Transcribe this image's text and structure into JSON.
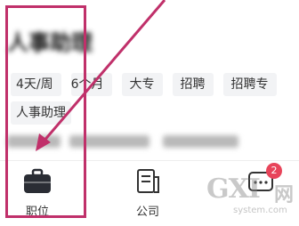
{
  "header": {
    "job_title": "人事助理"
  },
  "filters": {
    "chips": [
      "4天/周",
      "6个月",
      "大专",
      "招聘",
      "招聘专"
    ]
  },
  "tags": {
    "role_tag": "人事助理"
  },
  "tabbar": {
    "items": [
      {
        "label": "职位",
        "icon": "briefcase-icon",
        "active": true
      },
      {
        "label": "公司",
        "icon": "document-icon",
        "active": false
      },
      {
        "label": "",
        "icon": "message-icon",
        "active": false,
        "badge": "2"
      }
    ]
  },
  "watermark": {
    "brand": "GXI",
    "brand_cn": "网",
    "domain": "system.com"
  },
  "colors": {
    "highlight": "#c0306a",
    "badge": "#e8445a",
    "chip_bg": "#f2f3f5"
  }
}
